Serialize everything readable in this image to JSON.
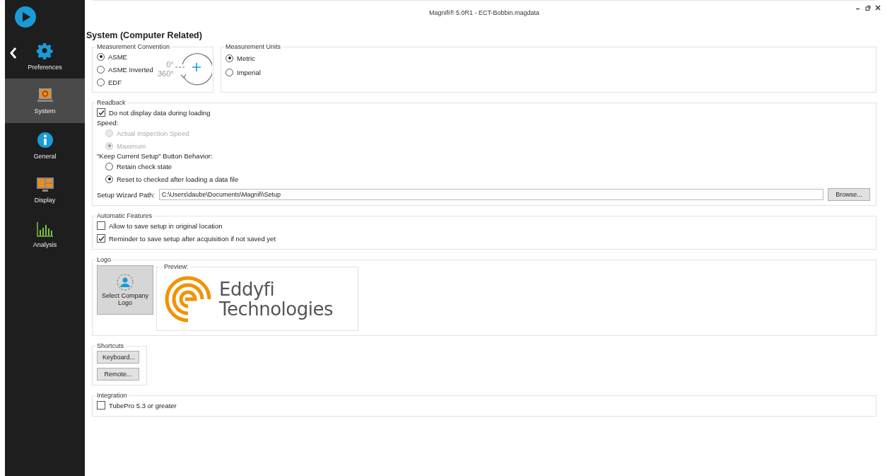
{
  "window": {
    "title": "Magnifi® 5.0R1 - ECT-Bobbin.magdata"
  },
  "sidebar": {
    "items": [
      {
        "label": "Preferences",
        "kind": "gear",
        "selected": false
      },
      {
        "label": "System",
        "kind": "monitor",
        "selected": true
      },
      {
        "label": "General",
        "kind": "info",
        "selected": false
      },
      {
        "label": "Display",
        "kind": "layout",
        "selected": false
      },
      {
        "label": "Analysis",
        "kind": "chart",
        "selected": false
      }
    ]
  },
  "heading": "System (Computer Related)",
  "measurement_convention": {
    "title": "Measurement Convention",
    "options": [
      {
        "label": "ASME",
        "selected": true
      },
      {
        "label": "ASME Inverted",
        "selected": false
      },
      {
        "label": "EDF",
        "selected": false
      }
    ],
    "diagram_labels": [
      "0°",
      "360°"
    ]
  },
  "measurement_units": {
    "title": "Measurement Units",
    "options": [
      {
        "label": "Metric",
        "selected": true
      },
      {
        "label": "Imperial",
        "selected": false
      }
    ]
  },
  "readback": {
    "title": "Readback",
    "checkbox": {
      "label": "Do not display data during loading",
      "checked": true
    },
    "speed_label": "Speed:",
    "speed_options": [
      {
        "label": "Actual Inspection Speed",
        "selected": false,
        "disabled": true
      },
      {
        "label": "Maximum",
        "selected": true,
        "disabled": true
      }
    ],
    "keep_label": "\"Keep Current Setup\" Button Behavior:",
    "keep_options": [
      {
        "label": "Retain check state",
        "selected": false,
        "disabled": false
      },
      {
        "label": "Reset to checked after loading a data file",
        "selected": true,
        "disabled": false
      }
    ],
    "path_label": "Setup Wizard Path:",
    "path_value": "C:\\Users\\daube\\Documents\\Magnifi\\Setup",
    "browse_button": "Browse..."
  },
  "automatic_features": {
    "title": "Automatic Features",
    "options": [
      {
        "label": "Allow to save setup in original location",
        "checked": false
      },
      {
        "label": "Reminder to save setup after acquisition if not saved yet",
        "checked": true
      }
    ]
  },
  "logo": {
    "title": "Logo",
    "select_button": "Select Company Logo",
    "preview_label": "Preview:",
    "logo_text": [
      "Eddyfi",
      "Technologies"
    ]
  },
  "shortcuts": {
    "title": "Shortcuts",
    "buttons": [
      "Keyboard...",
      "Remote..."
    ]
  },
  "integration": {
    "title": "Integration",
    "options": [
      {
        "label": "TubePro 5.3 or greater",
        "checked": false
      }
    ]
  }
}
